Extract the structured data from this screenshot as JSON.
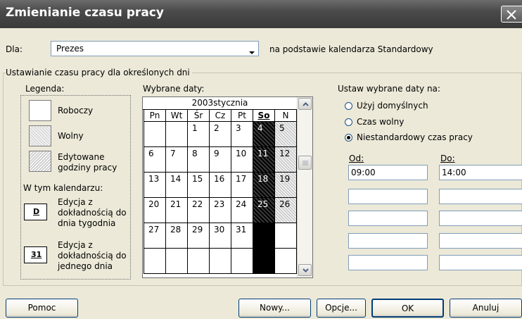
{
  "window": {
    "title": "Zmienianie czasu pracy"
  },
  "for_row": {
    "label": "Dla:",
    "selected": "Prezes",
    "base_text": "na podstawie kalendarza Standardowy"
  },
  "group_title": "Ustawianie czasu pracy dla określonych dni",
  "legend": {
    "title": "Legenda:",
    "items": [
      {
        "label": "Roboczy"
      },
      {
        "label": "Wolny"
      },
      {
        "label": "Edytowane\ngodziny pracy"
      }
    ],
    "calendar_title": "W tym kalendarzu:",
    "cal_items": [
      {
        "badge": "D",
        "label": "Edycja z\ndokładnością do\ndnia tygodnia"
      },
      {
        "badge": "31",
        "label": "Edycja z\ndokładnością do\njednego dnia"
      }
    ]
  },
  "calendar": {
    "label": "Wybrane daty:",
    "month": "2003stycznia",
    "weekdays": [
      "Pn",
      "Wt",
      "Śr",
      "Cz",
      "Pt",
      "So",
      "N"
    ],
    "weeks": [
      [
        "",
        "",
        "1",
        "2",
        "3",
        "4",
        "5"
      ],
      [
        "6",
        "7",
        "8",
        "9",
        "10",
        "11",
        "12"
      ],
      [
        "13",
        "14",
        "15",
        "16",
        "17",
        "18",
        "19"
      ],
      [
        "20",
        "21",
        "22",
        "23",
        "24",
        "25",
        "26"
      ],
      [
        "27",
        "28",
        "29",
        "30",
        "31",
        "",
        ""
      ],
      [
        "",
        "",
        "",
        "",
        "",
        "",
        ""
      ]
    ]
  },
  "set_dates": {
    "title": "Ustaw wybrane daty na:",
    "options": [
      {
        "label": "Użyj domyślnych",
        "selected": false
      },
      {
        "label": "Czas wolny",
        "selected": false
      },
      {
        "label": "Niestandardowy czas pracy",
        "selected": true
      }
    ],
    "from_label": "Od:",
    "to_label": "Do:",
    "from_values": [
      "09:00",
      "",
      "",
      "",
      ""
    ],
    "to_values": [
      "14:00",
      "",
      "",
      "",
      ""
    ]
  },
  "buttons": {
    "help": "Pomoc",
    "new": "Nowy...",
    "options": "Opcje...",
    "ok": "OK",
    "cancel": "Anuluj"
  }
}
